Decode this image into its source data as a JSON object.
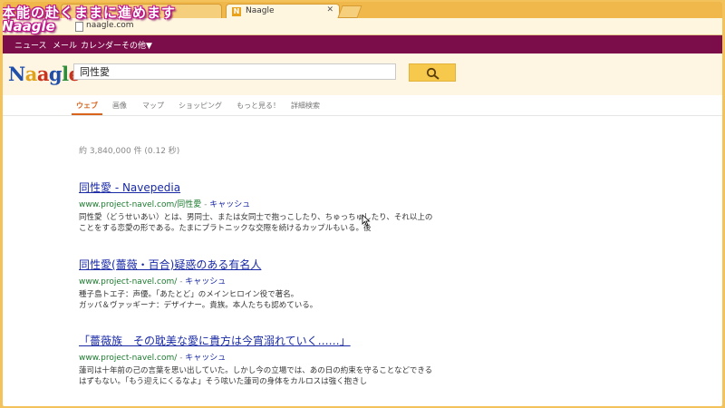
{
  "overlay": {
    "title": "本能の赴くままに進めます",
    "subtitle": "Naagle"
  },
  "browser": {
    "tabs": [
      {
        "label": ""
      },
      {
        "label": "Naagle",
        "favicon": "N"
      }
    ],
    "address": "naagle.com"
  },
  "topnav": {
    "items": [
      "ニュース",
      "メール",
      "カレンダー",
      "その他▼"
    ]
  },
  "logo": {
    "letters": [
      {
        "ch": "N",
        "color": "#1f4fa8"
      },
      {
        "ch": "a",
        "color": "#e0a21a"
      },
      {
        "ch": "a",
        "color": "#c9341e"
      },
      {
        "ch": "g",
        "color": "#1f4fa8"
      },
      {
        "ch": "l",
        "color": "#2f8c3a"
      },
      {
        "ch": "e",
        "color": "#c9341e"
      }
    ]
  },
  "search": {
    "query": "同性愛"
  },
  "nav": {
    "tabs": [
      "ウェブ",
      "画像",
      "マップ",
      "ショッピング",
      "もっと見る！",
      "詳細検索"
    ],
    "active": 0
  },
  "stats": "約 3,840,000 件 (0.12 秒)",
  "results": [
    {
      "title": "同性愛 - Navepedia",
      "url": "www.project-navel.com/同性愛",
      "cache": "キャッシュ",
      "lines": [
        "同性愛（どうせいあい）とは、男同士、または女同士で抱っこしたり、ちゅっちゅしたり、それ以上のことをする恋愛の形である。たまにプラトニックな交際を続けるカップルもいる。後"
      ]
    },
    {
      "title": "同性愛(薔薇・百合)疑惑のある有名人",
      "url": "www.project-navel.com/",
      "cache": "キャッシュ",
      "lines": [
        "種子島トエ子：声優。「あたとど」のメインヒロイン役で著名。",
        "ガッパ＆ヴァッギーナ：デザイナー。貴族。本人たちも認めている。"
      ]
    },
    {
      "title": "「薔薇族　その耽美な愛に貴方は今宵溺れていく……」",
      "url": "www.project-navel.com/",
      "cache": "キャッシュ",
      "lines": [
        "蓮司は十年前の己の言葉を思い出していた。しかし今の立場では、あの日の約束を守ることなどできるはずもない。「もう迎えにくるなよ」そう呟いた蓮司の身体をカルロスは強く抱きし"
      ]
    }
  ]
}
